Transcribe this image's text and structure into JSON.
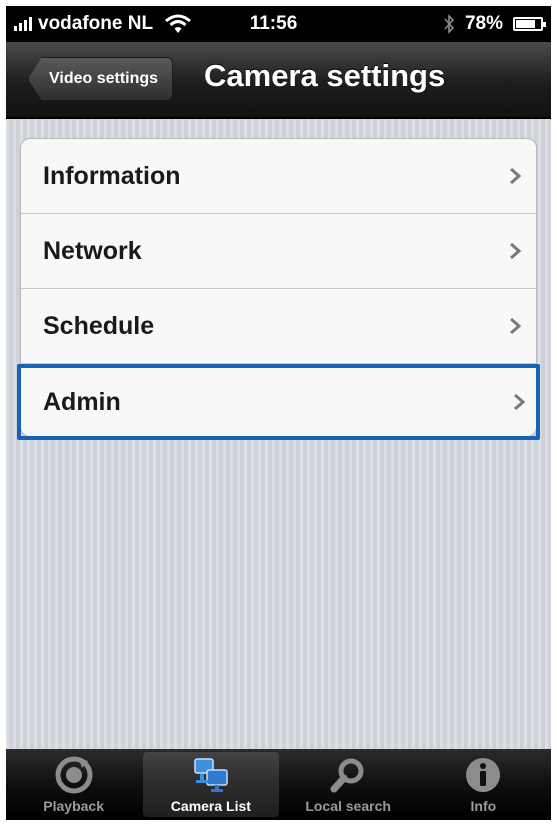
{
  "status_bar": {
    "carrier": "vodafone NL",
    "time": "11:56",
    "battery": "78%",
    "battery_level": 0.78
  },
  "nav": {
    "back_label": "Video settings",
    "title": "Camera settings"
  },
  "menu": {
    "items": [
      {
        "label": "Information"
      },
      {
        "label": "Network"
      },
      {
        "label": "Schedule"
      },
      {
        "label": "Admin"
      }
    ],
    "highlighted_color": "#1565b4"
  },
  "tabs": [
    {
      "label": "Playback",
      "icon": "playback-icon",
      "active": false
    },
    {
      "label": "Camera List",
      "icon": "camera-list-icon",
      "active": true
    },
    {
      "label": "Local search",
      "icon": "search-icon",
      "active": false
    },
    {
      "label": "Info",
      "icon": "info-icon",
      "active": false
    }
  ]
}
